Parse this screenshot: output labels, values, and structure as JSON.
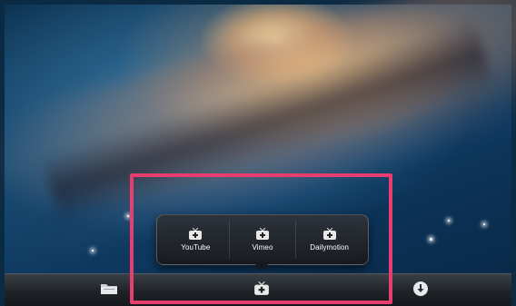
{
  "popover": {
    "items": [
      {
        "label": "YouTube",
        "icon": "tv-plus-icon"
      },
      {
        "label": "Vimeo",
        "icon": "tv-plus-icon"
      },
      {
        "label": "Dailymotion",
        "icon": "tv-plus-icon"
      }
    ]
  },
  "toolbar": {
    "buttons": [
      {
        "icon": "folder-icon"
      },
      {
        "icon": "tv-plus-icon"
      },
      {
        "icon": "download-icon"
      }
    ]
  },
  "colors": {
    "highlight": "#e83e6f",
    "toolbar": "#1f2328"
  }
}
